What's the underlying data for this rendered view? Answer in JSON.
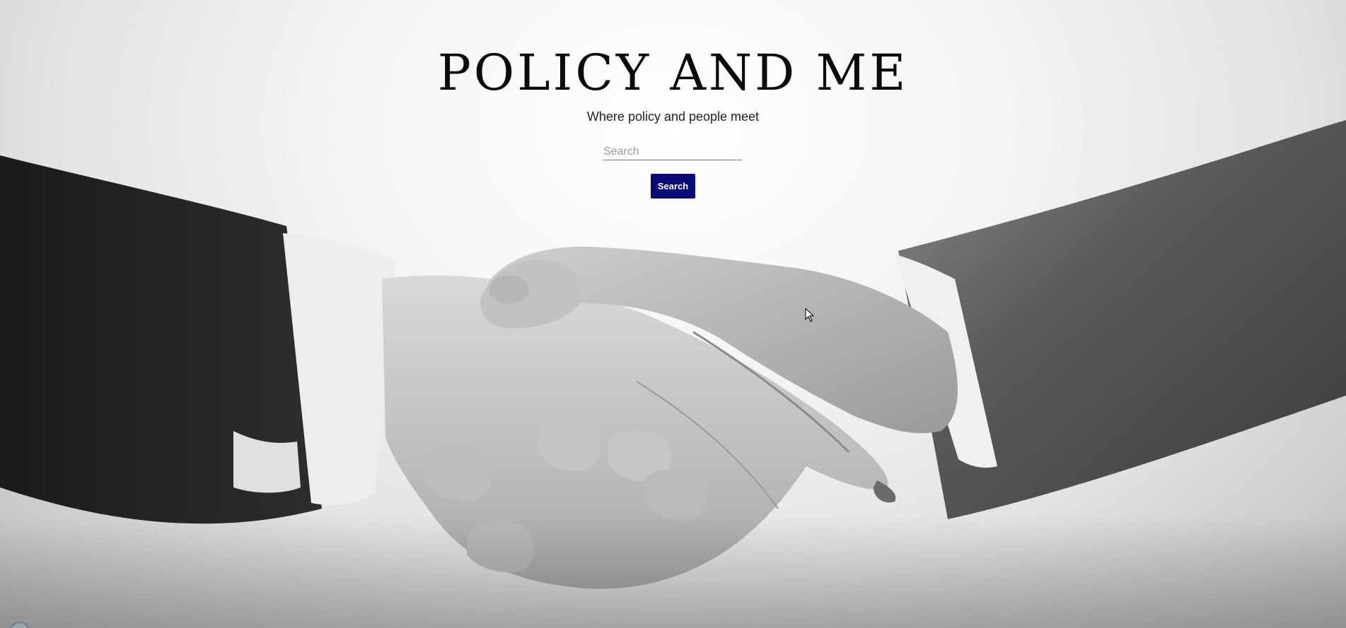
{
  "site": {
    "title": "POLICY AND ME",
    "tagline": "Where policy and people meet"
  },
  "search": {
    "placeholder": "Search",
    "value": "",
    "button_label": "Search"
  },
  "colors": {
    "accent": "#0b0b78"
  },
  "icons": {
    "cursor": "cursor-icon",
    "background": "handshake-image"
  }
}
